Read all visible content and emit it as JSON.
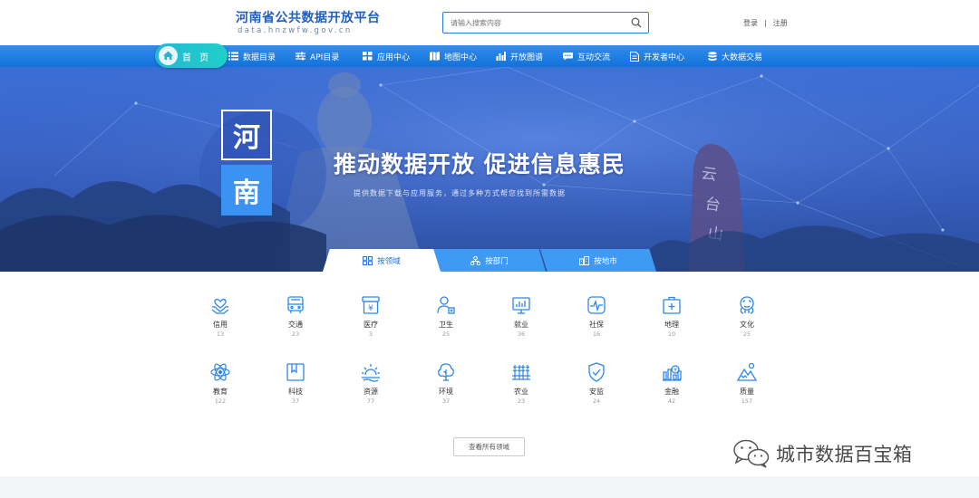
{
  "site": {
    "title": "河南省公共数据开放平台",
    "subtitle": "data.hnzwfw.gov.cn"
  },
  "search": {
    "placeholder": "请输入搜索内容",
    "icon": "search-icon"
  },
  "auth": {
    "login": "登录",
    "separator": "|",
    "register": "注册"
  },
  "nav": {
    "home": "首 页",
    "items": [
      {
        "label": "数据目录",
        "icon": "list-icon"
      },
      {
        "label": "API目录",
        "icon": "sliders-icon"
      },
      {
        "label": "应用中心",
        "icon": "grid-icon"
      },
      {
        "label": "地图中心",
        "icon": "map-icon"
      },
      {
        "label": "开放图谱",
        "icon": "bar-chart-icon"
      },
      {
        "label": "互动交流",
        "icon": "chat-icon"
      },
      {
        "label": "开发者中心",
        "icon": "document-icon"
      },
      {
        "label": "大数据交易",
        "icon": "database-icon"
      }
    ]
  },
  "banner": {
    "tile_1": "河",
    "tile_2": "南",
    "slogan": "推动数据开放  促进信息惠民",
    "subtitle": "提供数据下载与应用服务，通过多种方式帮您找到所需数据"
  },
  "tabs": [
    {
      "label": "按领域",
      "icon": "grid-icon",
      "active": true
    },
    {
      "label": "按部门",
      "icon": "org-icon",
      "active": false
    },
    {
      "label": "按地市",
      "icon": "city-icon",
      "active": false
    }
  ],
  "domains": [
    {
      "name": "信用",
      "count": "13",
      "icon": "credit-icon"
    },
    {
      "name": "交通",
      "count": "23",
      "icon": "bus-icon"
    },
    {
      "name": "医疗",
      "count": "3",
      "icon": "medical-icon"
    },
    {
      "name": "卫生",
      "count": "25",
      "icon": "health-icon"
    },
    {
      "name": "就业",
      "count": "36",
      "icon": "employment-icon"
    },
    {
      "name": "社保",
      "count": "16",
      "icon": "social-security-icon"
    },
    {
      "name": "地理",
      "count": "10",
      "icon": "geography-icon"
    },
    {
      "name": "文化",
      "count": "25",
      "icon": "culture-icon"
    },
    {
      "name": "教育",
      "count": "122",
      "icon": "education-icon"
    },
    {
      "name": "科技",
      "count": "37",
      "icon": "technology-icon"
    },
    {
      "name": "资源",
      "count": "77",
      "icon": "resources-icon"
    },
    {
      "name": "环境",
      "count": "37",
      "icon": "environment-icon"
    },
    {
      "name": "农业",
      "count": "23",
      "icon": "agriculture-icon"
    },
    {
      "name": "安监",
      "count": "24",
      "icon": "safety-icon"
    },
    {
      "name": "金融",
      "count": "42",
      "icon": "finance-icon"
    },
    {
      "name": "质量",
      "count": "157",
      "icon": "quality-icon"
    }
  ],
  "view_all_label": "查看所有领域",
  "watermark": {
    "text": "城市数据百宝箱",
    "icon": "wechat-icon"
  },
  "colors": {
    "brand_blue": "#1f5fbf",
    "nav_blue": "#1f7fe6",
    "accent_cyan": "#22c3cc",
    "icon_blue": "#2d86e8"
  }
}
